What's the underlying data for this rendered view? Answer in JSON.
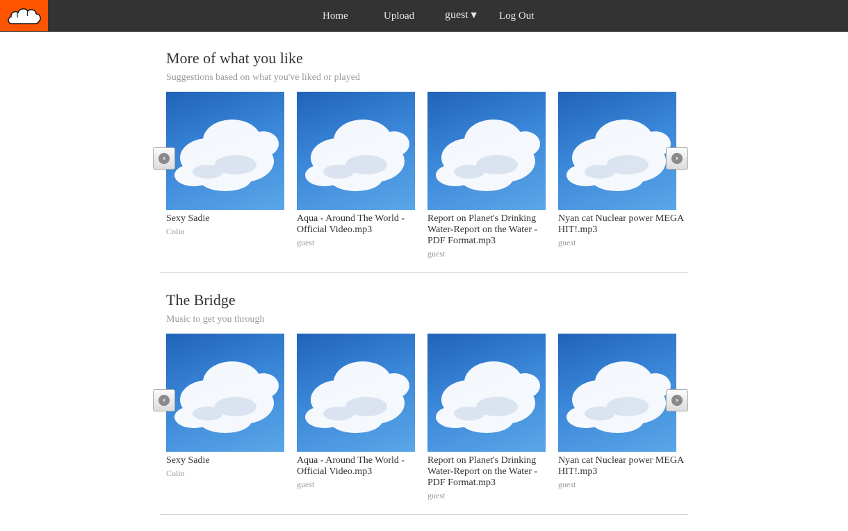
{
  "nav": {
    "home": "Home",
    "upload": "Upload",
    "user": "guest",
    "user_caret": "▼",
    "logout": "Log Out"
  },
  "colors": {
    "brand": "#ff5500",
    "navbar": "#333333",
    "sky": "#2f7bd0"
  },
  "sections": [
    {
      "title": "More of what you like",
      "subtitle": "Suggestions based on what you've liked or played",
      "tracks": [
        {
          "title": "Sexy Sadie",
          "user": "Colin"
        },
        {
          "title": "Aqua - Around The World - Official Video.mp3",
          "user": "guest"
        },
        {
          "title": "Report on Planet's Drinking Water-Report on the Water - PDF Format.mp3",
          "user": "guest"
        },
        {
          "title": "Nyan cat Nuclear power MEGA HIT!.mp3",
          "user": "guest"
        }
      ]
    },
    {
      "title": "The Bridge",
      "subtitle": "Music to get you through",
      "tracks": [
        {
          "title": "Sexy Sadie",
          "user": "Colin"
        },
        {
          "title": "Aqua - Around The World - Official Video.mp3",
          "user": "guest"
        },
        {
          "title": "Report on Planet's Drinking Water-Report on the Water - PDF Format.mp3",
          "user": "guest"
        },
        {
          "title": "Nyan cat Nuclear power MEGA HIT!.mp3",
          "user": "guest"
        }
      ]
    }
  ],
  "icons": {
    "logo": "cloud-logo-icon",
    "prev": "chevron-left-circle-icon",
    "next": "chevron-right-circle-icon",
    "artwork": "cloud-sky-artwork"
  }
}
